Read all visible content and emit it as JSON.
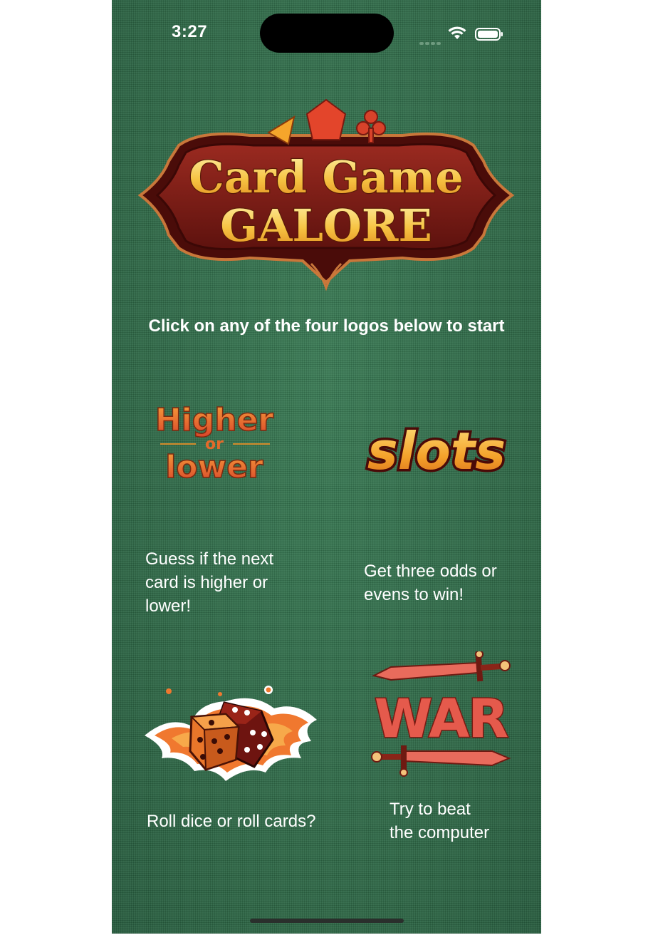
{
  "status_bar": {
    "time": "3:27",
    "icons": [
      "cellular-icon",
      "wifi-icon",
      "battery-icon"
    ]
  },
  "logo": {
    "line1": "Card Game",
    "line2": "GALORE"
  },
  "instruction": "Click on any of the four logos below to start",
  "games": [
    {
      "id": "higher-or-lower",
      "logo_words": [
        "Higher",
        "or",
        "lower"
      ],
      "caption_lines": [
        "Guess if the next",
        "card is higher or",
        "lower!"
      ]
    },
    {
      "id": "slots",
      "logo_text": "slots",
      "caption_lines": [
        "Get three odds or",
        "evens to win!"
      ]
    },
    {
      "id": "dice",
      "caption_lines": [
        "Roll dice or roll cards?"
      ]
    },
    {
      "id": "war",
      "logo_text": "WAR",
      "caption_lines": [
        "Try to beat",
        "the computer"
      ]
    }
  ],
  "colors": {
    "felt": "#2f6b48",
    "logo_maroon": "#7a1a14",
    "logo_gold": "#f6c342",
    "accent_orange": "#e0662a",
    "war_red": "#e55a4c"
  }
}
